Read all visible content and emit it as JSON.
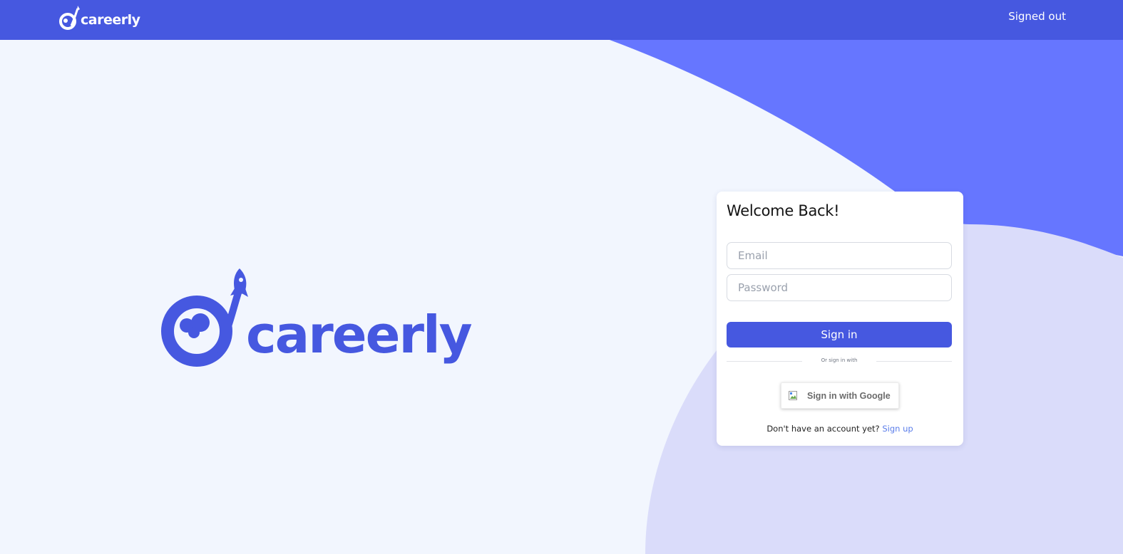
{
  "brand": {
    "name": "careerly",
    "primary_color": "#4658e0",
    "blob_color": "#6676ff",
    "soft_color": "#dadcfa",
    "background_color": "#f2f6fe"
  },
  "header": {
    "logo_text": "careerly",
    "status_link": "Signed out"
  },
  "hero": {
    "logo_text": "careerly"
  },
  "login": {
    "title": "Welcome Back!",
    "email_placeholder": "Email",
    "password_placeholder": "Password",
    "submit_label": "Sign in",
    "divider_text": "Or sign in with",
    "google_label": "Sign in with Google",
    "signup_prompt": "Don't have an account yet?",
    "signup_link": "Sign up"
  }
}
